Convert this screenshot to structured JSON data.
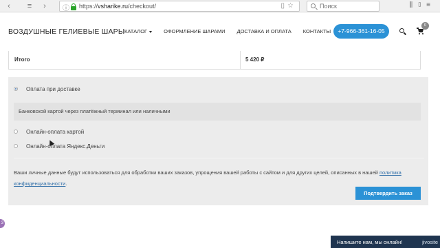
{
  "browser": {
    "url_prefix": "https://",
    "url_host": "vsharike.ru",
    "url_path": "/checkout/",
    "search_placeholder": "Поиск"
  },
  "header": {
    "logo": "ВОЗДУШНЫЕ ГЕЛИЕВЫЕ ШАРЫ",
    "nav": [
      "КАТАЛОГ",
      "ОФОРМЛЕНИЕ ШАРАМИ",
      "ДОСТАВКА И ОПЛАТА",
      "КОНТАКТЫ"
    ],
    "phone": "+7-966-361-16-05",
    "cart_count": "0"
  },
  "totals": {
    "label": "Итого",
    "value": "5 420 ₽"
  },
  "payment": {
    "options": [
      {
        "label": "Оплата при доставке",
        "selected": true
      },
      {
        "label": "Онлайн-оплата картой",
        "selected": false
      },
      {
        "label": "Онлайн-оплата Яндекс.Деньги",
        "selected": false
      }
    ],
    "description": "Банковской картой через платёжный терминал или наличными",
    "privacy_text": "Ваши личные данные будут использоваться для обработки ваших заказов, упрощения вашей работы с сайтом и для других целей, описанных в нашей",
    "privacy_link": "политика конфиденциальности",
    "privacy_tail": ".",
    "confirm_label": "Подтвердить заказ"
  },
  "widgets": {
    "side_badge": "3",
    "chat_text": "Напишите нам, мы онлайн!",
    "chat_brand": "jivosite"
  },
  "colors": {
    "accent": "#2b92d6",
    "chat_bg": "#1f3550"
  }
}
